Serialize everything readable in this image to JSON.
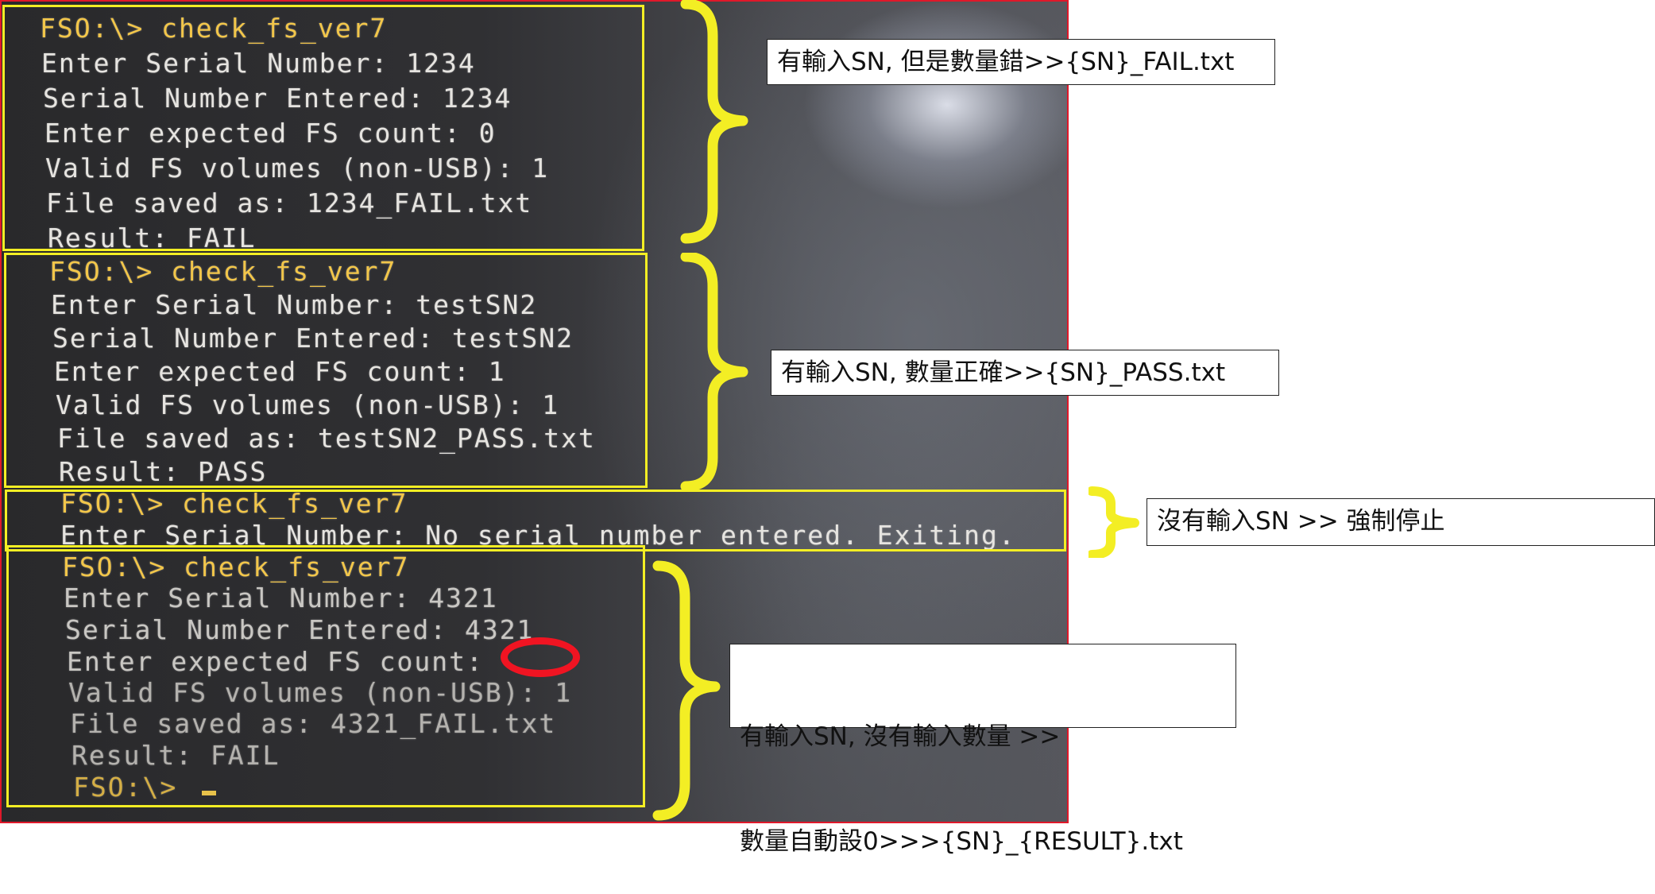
{
  "terminal": {
    "block1": [
      "FSO:\\> check_fs_ver7",
      "Enter Serial Number: 1234",
      "Serial Number Entered: 1234",
      "Enter expected FS count: 0",
      "Valid FS volumes (non-USB): 1",
      "File saved as: 1234_FAIL.txt",
      "Result: FAIL"
    ],
    "block2": [
      "FSO:\\> check_fs_ver7",
      "Enter Serial Number: testSN2",
      "Serial Number Entered: testSN2",
      "Enter expected FS count: 1",
      "Valid FS volumes (non-USB): 1",
      "File saved as: testSN2_PASS.txt",
      "Result: PASS"
    ],
    "block3": [
      "FSO:\\> check_fs_ver7",
      "Enter Serial Number: No serial number entered. Exiting."
    ],
    "block4": [
      "FSO:\\> check_fs_ver7",
      "Enter Serial Number: 4321",
      "Serial Number Entered: 4321",
      "Enter expected FS count:",
      "Valid FS volumes (non-USB): 1",
      "File saved as: 4321_FAIL.txt",
      "Result: FAIL",
      "FSO:\\>"
    ]
  },
  "callouts": {
    "c1": "有輸入SN, 但是數量錯>>{SN}_FAIL.txt",
    "c2": "有輸入SN, 數量正確>>{SN}_PASS.txt",
    "c3": "沒有輸入SN >> 強制停止",
    "c4_line1": "有輸入SN, 沒有輸入數量 >>",
    "c4_line2": "數量自動設0>>>{SN}_{RESULT}.txt"
  },
  "colors": {
    "highlight_box": "#f3ee24",
    "brace": "#f3ee24",
    "circle_mark": "#f01422",
    "photo_border": "#e0182a",
    "prompt": "#f2c64a"
  }
}
